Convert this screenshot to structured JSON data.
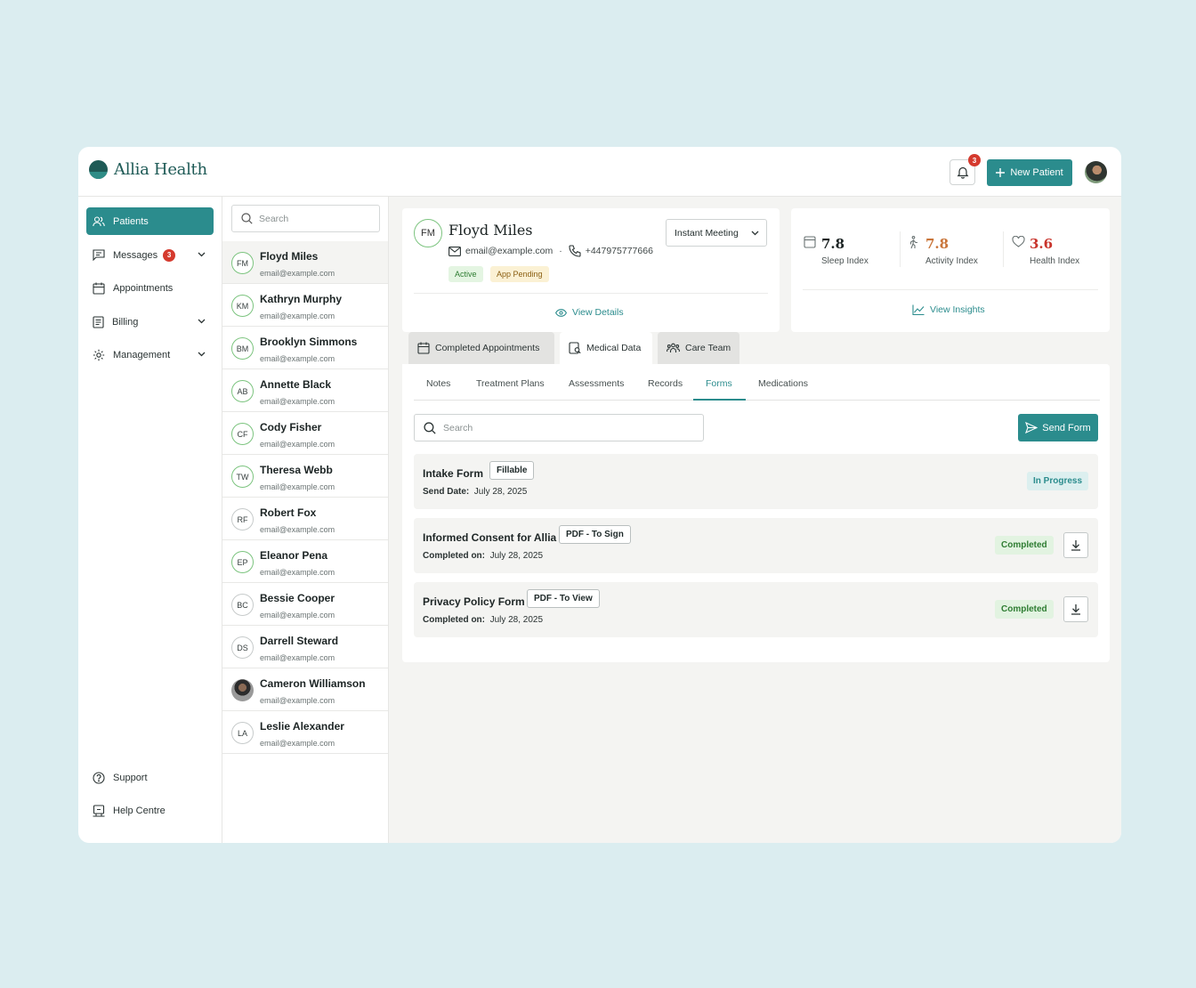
{
  "app": {
    "name": "Allia Health",
    "notification_count": "3",
    "new_patient_label": "New Patient"
  },
  "sidebar": {
    "items": [
      {
        "label": "Patients",
        "icon": "users-icon"
      },
      {
        "label": "Messages",
        "badge": "3",
        "icon": "message-icon"
      },
      {
        "label": "Appointments",
        "icon": "calendar-icon"
      },
      {
        "label": "Billing",
        "icon": "billing-icon"
      },
      {
        "label": "Management",
        "icon": "gear-icon"
      }
    ],
    "bottom": [
      {
        "label": "Support",
        "icon": "help-circle-icon"
      },
      {
        "label": "Help Centre",
        "icon": "help-centre-icon"
      }
    ]
  },
  "patient_list": {
    "search_placeholder": "Search",
    "patients": [
      {
        "initials": "FM",
        "name": "Floyd Miles",
        "email": "email@example.com"
      },
      {
        "initials": "KM",
        "name": "Kathryn Murphy",
        "email": "email@example.com"
      },
      {
        "initials": "BM",
        "name": "Brooklyn Simmons",
        "email": "email@example.com"
      },
      {
        "initials": "AB",
        "name": "Annette Black",
        "email": "email@example.com"
      },
      {
        "initials": "CF",
        "name": "Cody Fisher",
        "email": "email@example.com"
      },
      {
        "initials": "TW",
        "name": "Theresa Webb",
        "email": "email@example.com"
      },
      {
        "initials": "RF",
        "name": "Robert Fox",
        "email": "email@example.com"
      },
      {
        "initials": "EP",
        "name": "Eleanor Pena",
        "email": "email@example.com"
      },
      {
        "initials": "BC",
        "name": "Bessie Cooper",
        "email": "email@example.com"
      },
      {
        "initials": "DS",
        "name": "Darrell Steward",
        "email": "email@example.com"
      },
      {
        "initials": "",
        "name": "Cameron Williamson",
        "email": "email@example.com"
      },
      {
        "initials": "LA",
        "name": "Leslie Alexander",
        "email": "email@example.com"
      }
    ]
  },
  "profile": {
    "initials": "FM",
    "name": "Floyd Miles",
    "email": "email@example.com",
    "separator": "·",
    "phone": "+447975777666",
    "tags": [
      "Active",
      "App Pending"
    ],
    "meeting_label": "Instant Meeting",
    "view_details": "View Details"
  },
  "insights": {
    "stats": [
      {
        "value": "7.8",
        "label": "Sleep Index",
        "color": "#1b2323"
      },
      {
        "value": "7.8",
        "label": "Activity Index",
        "color": "#c9753a"
      },
      {
        "value": "3.6",
        "label": "Health Index",
        "color": "#c8342c"
      }
    ],
    "view_insights": "View Insights"
  },
  "tabs": [
    "Completed Appointments",
    "Medical Data",
    "Care Team"
  ],
  "subtabs": [
    "Notes",
    "Treatment Plans",
    "Assessments",
    "Records",
    "Forms",
    "Medications"
  ],
  "forms": {
    "search_placeholder": "Search",
    "send_label": "Send Form",
    "items": [
      {
        "title": "Intake Form",
        "type": "Fillable",
        "meta_label": "Send Date:",
        "meta_date": "July 28, 2025",
        "status": "In Progress"
      },
      {
        "title": "Informed Consent for Allia",
        "type": "PDF - To Sign",
        "meta_label": "Completed on:",
        "meta_date": "July 28, 2025",
        "status": "Completed"
      },
      {
        "title": "Privacy Policy Form",
        "type": "PDF - To View",
        "meta_label": "Completed on:",
        "meta_date": "July 28, 2025",
        "status": "Completed"
      }
    ]
  },
  "colors": {
    "accent": "#2b8c8d",
    "brand": "#1e5a56",
    "alert": "#d53a2e"
  }
}
